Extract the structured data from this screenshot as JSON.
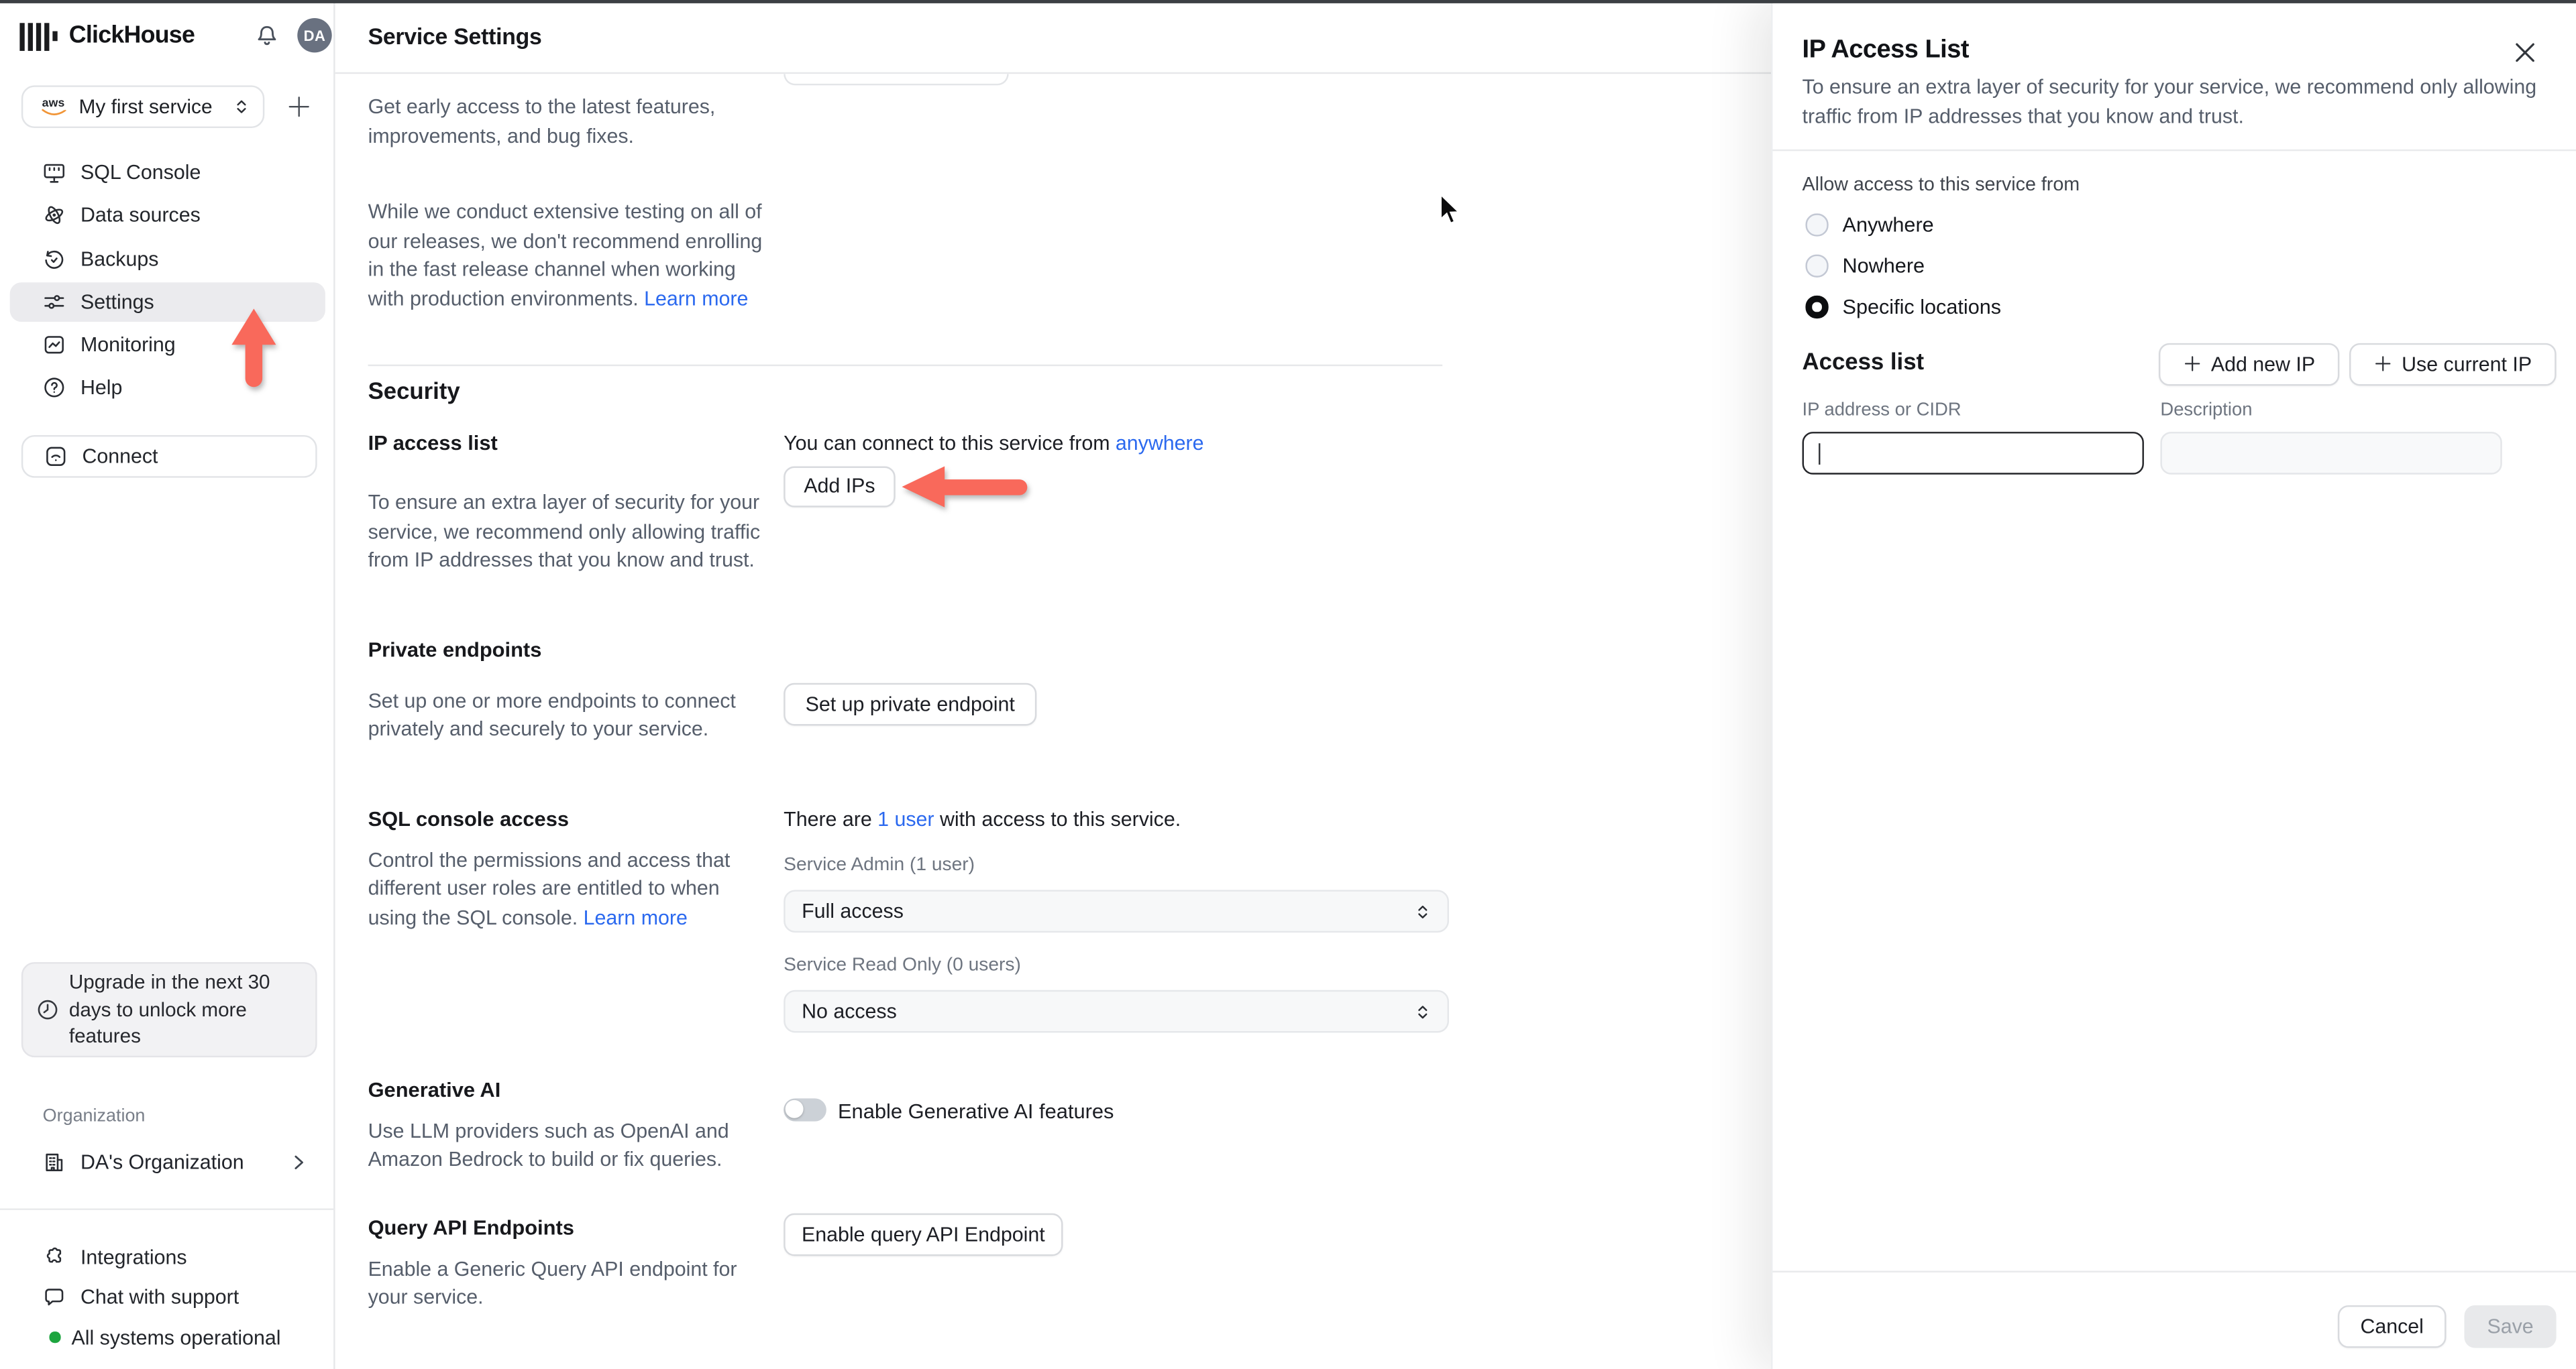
{
  "colors": {
    "accent_arrow": "#f9695b",
    "link_blue": "#2b69ef",
    "status_green": "#1da53f",
    "avatar_bg": "#697180",
    "aws_orange": "#f19537"
  },
  "sidebar": {
    "brand": "ClickHouse",
    "avatar_initials": "DA",
    "service": {
      "provider": "aws",
      "name": "My first service"
    },
    "nav": [
      {
        "label": "SQL Console"
      },
      {
        "label": "Data sources"
      },
      {
        "label": "Backups"
      },
      {
        "label": "Settings",
        "active": true
      },
      {
        "label": "Monitoring"
      },
      {
        "label": "Help"
      }
    ],
    "connect_label": "Connect",
    "upgrade_note": "Upgrade in the next 30 days to unlock more features",
    "organization_section_label": "Organization",
    "organization_name": "DA's Organization",
    "footer": {
      "integrations": "Integrations",
      "chat": "Chat with support",
      "status": "All systems operational"
    }
  },
  "header": {
    "title": "Service Settings"
  },
  "main": {
    "release_channel": {
      "para1": "Get early access to the latest features, improvements, and bug fixes.",
      "para2": "While we conduct extensive testing on all of our releases, we don't recommend enrolling in the fast release channel when working with production environments. ",
      "learn_more": "Learn more"
    },
    "security": {
      "heading": "Security",
      "ip_access_list": {
        "label": "IP access list",
        "connect_text": "You can connect to this service from ",
        "connect_link": "anywhere",
        "add_ips_button": "Add IPs",
        "description": "To ensure an extra layer of security for your service, we recommend only allowing traffic from IP addresses that you know and trust."
      },
      "private_endpoints": {
        "label": "Private endpoints",
        "description": "Set up one or more endpoints to connect privately and securely to your service.",
        "button": "Set up private endpoint"
      },
      "sql_console_access": {
        "label": "SQL console access",
        "users_prefix": "There are ",
        "users_link": "1 user",
        "users_suffix": " with access to this service.",
        "description": "Control the permissions and access that different user roles are entitled to when using the SQL console. ",
        "learn_more": "Learn more",
        "admin_label": "Service Admin (1 user)",
        "admin_value": "Full access",
        "readonly_label": "Service Read Only (0 users)",
        "readonly_value": "No access"
      },
      "generative_ai": {
        "label": "Generative AI",
        "toggle_label": "Enable Generative AI features",
        "toggle_on": false,
        "description": "Use LLM providers such as OpenAI and Amazon Bedrock to build or fix queries."
      },
      "query_api": {
        "label": "Query API Endpoints",
        "button": "Enable query API Endpoint",
        "description": "Enable a Generic Query API endpoint for your service."
      }
    }
  },
  "panel": {
    "title": "IP Access List",
    "description": "To ensure an extra layer of security for your service, we recommend only allowing traffic from IP addresses that you know and trust.",
    "allow_label": "Allow access to this service from",
    "radios": [
      {
        "label": "Anywhere",
        "selected": false
      },
      {
        "label": "Nowhere",
        "selected": false
      },
      {
        "label": "Specific locations",
        "selected": true
      }
    ],
    "access_list_title": "Access list",
    "add_new_ip_button": "Add new IP",
    "use_current_ip_button": "Use current IP",
    "ip_field": {
      "label": "IP address or CIDR",
      "value": "",
      "placeholder": ""
    },
    "description_field": {
      "label": "Description",
      "value": "",
      "placeholder": ""
    },
    "cancel_button": "Cancel",
    "save_button": "Save"
  }
}
